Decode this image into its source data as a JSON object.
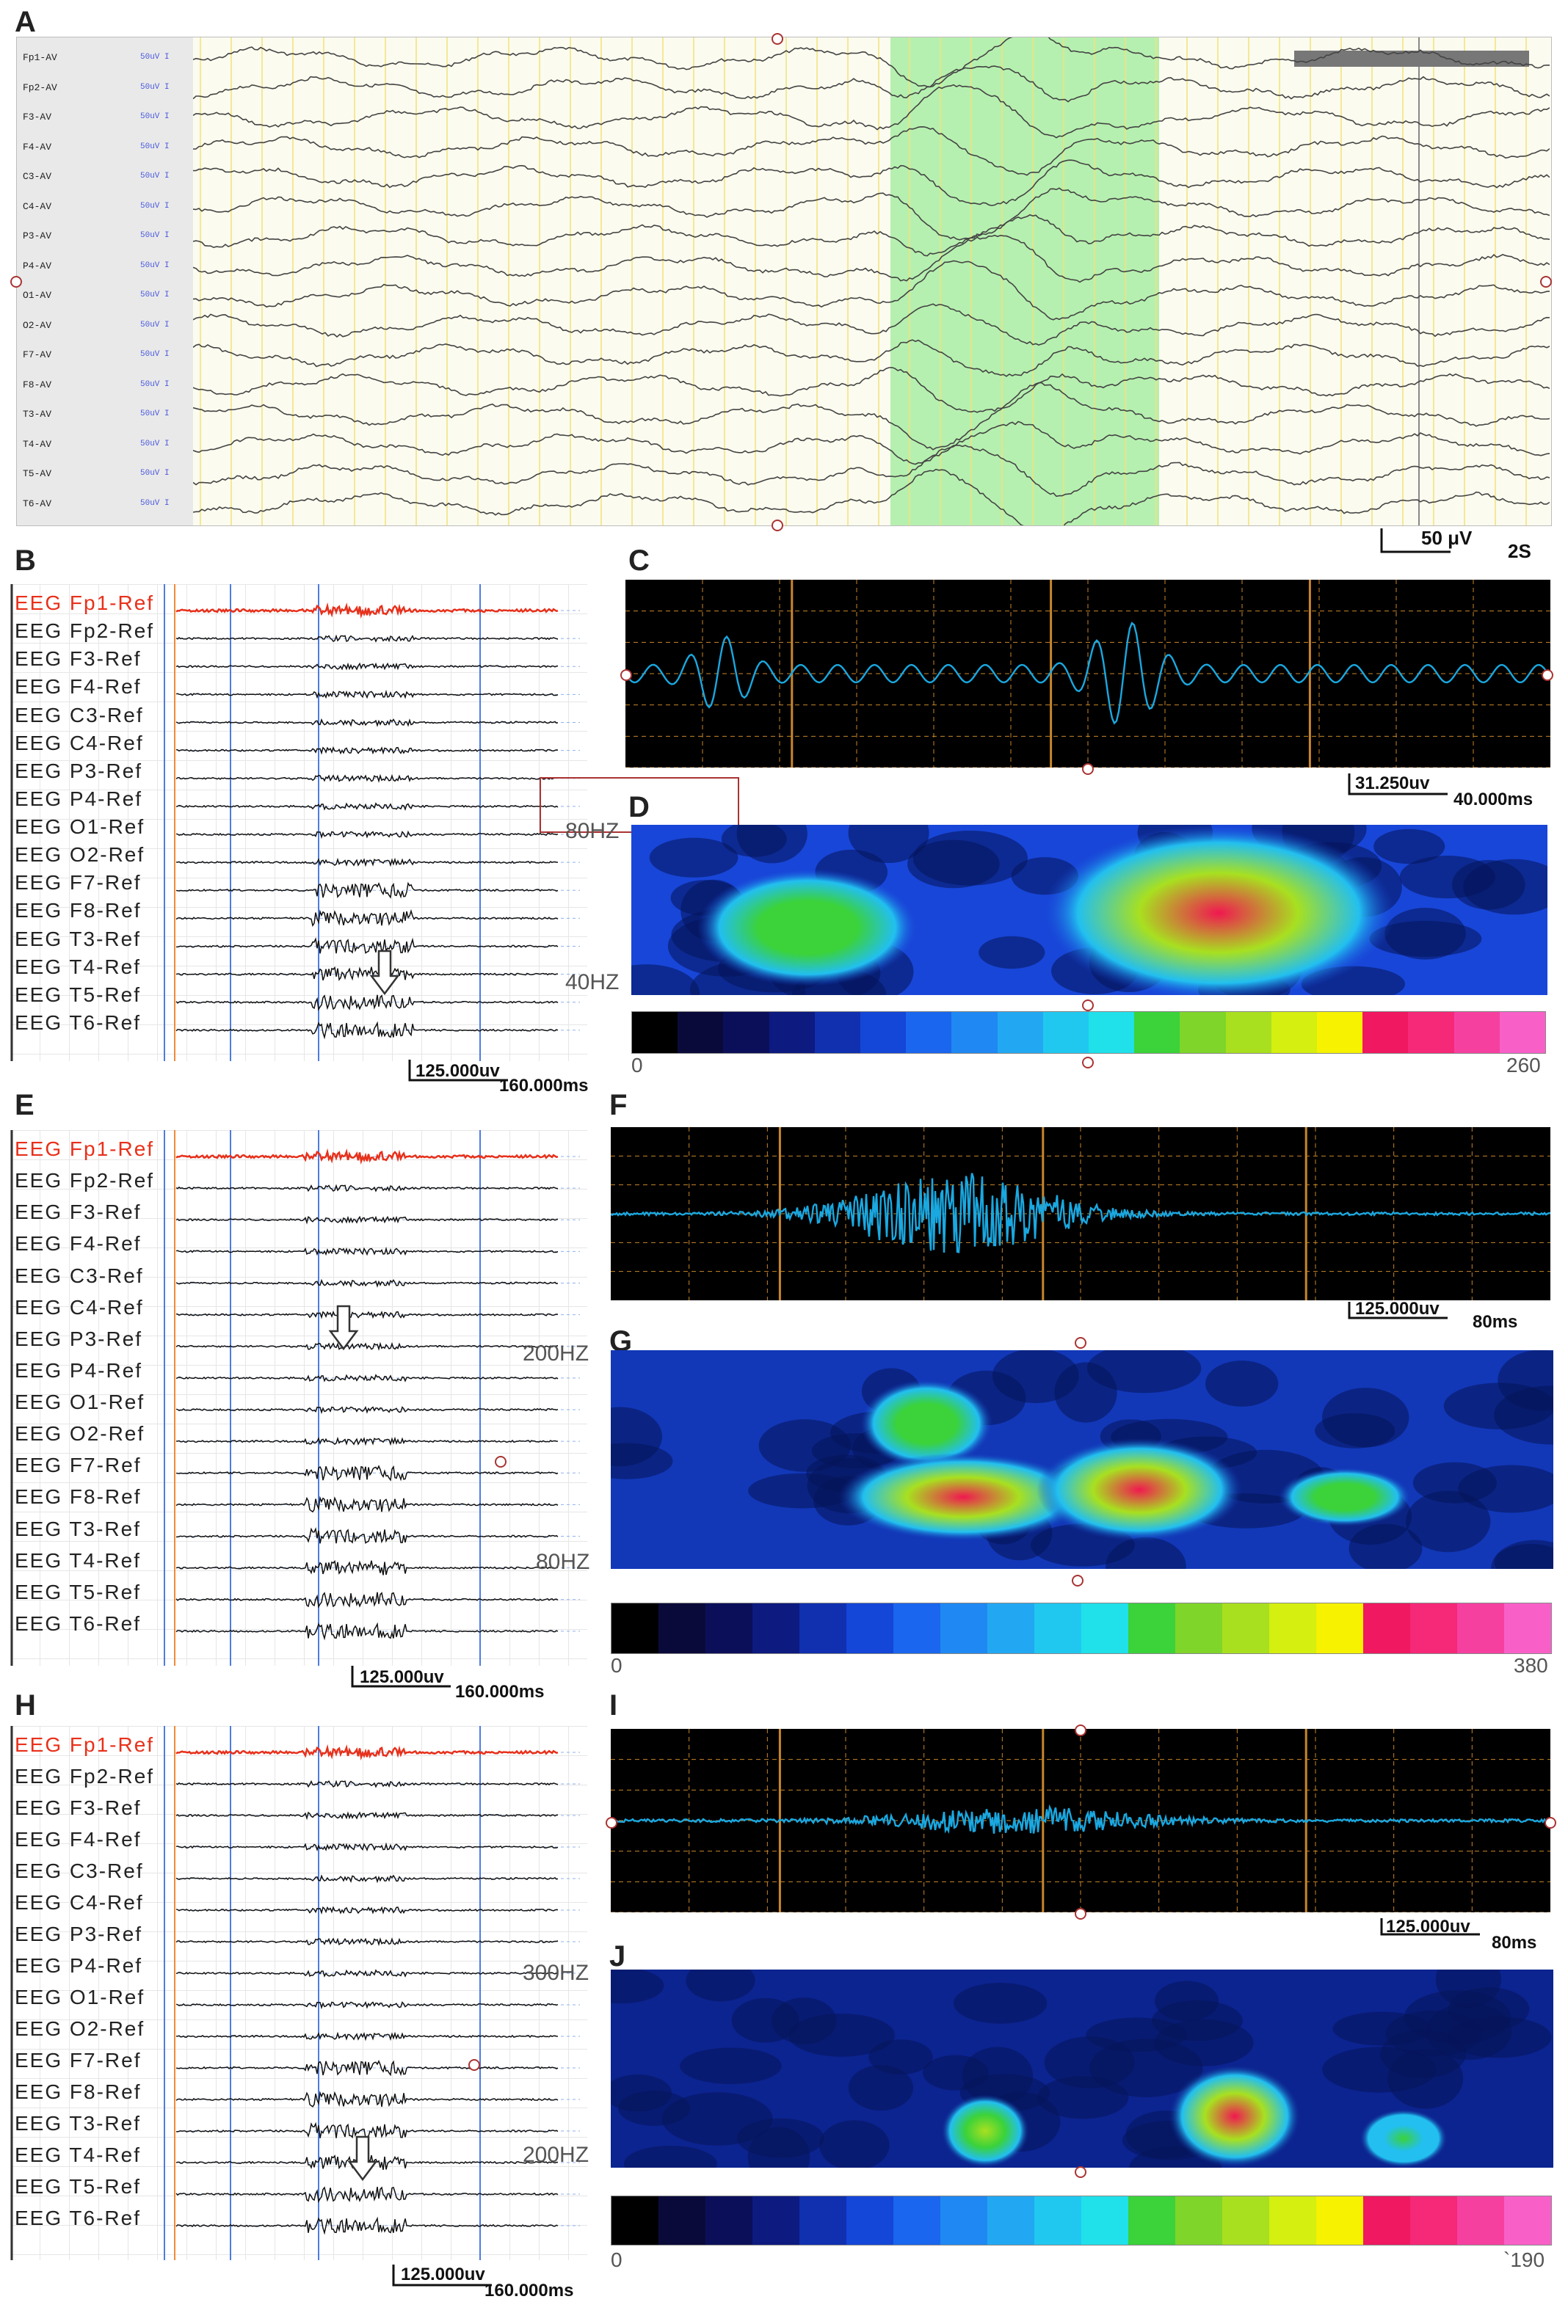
{
  "panels": {
    "a": "A",
    "b": "B",
    "c": "C",
    "d": "D",
    "e": "E",
    "f": "F",
    "g": "G",
    "h": "H",
    "i": "I",
    "j": "J"
  },
  "panel_a": {
    "channels": [
      "Fp1-AV",
      "Fp2-AV",
      "F3-AV",
      "F4-AV",
      "C3-AV",
      "C4-AV",
      "P3-AV",
      "P4-AV",
      "O1-AV",
      "O2-AV",
      "F7-AV",
      "F8-AV",
      "T3-AV",
      "T4-AV",
      "T5-AV",
      "T6-AV"
    ],
    "sensitivity": "50uV",
    "scale_amplitude": "50 μV",
    "scale_time": "2S"
  },
  "panel_b": {
    "channels": [
      "EEG Fp1-Ref",
      "EEG Fp2-Ref",
      "EEG F3-Ref",
      "EEG F4-Ref",
      "EEG C3-Ref",
      "EEG C4-Ref",
      "EEG P3-Ref",
      "EEG P4-Ref",
      "EEG O1-Ref",
      "EEG O2-Ref",
      "EEG F7-Ref",
      "EEG F8-Ref",
      "EEG T3-Ref",
      "EEG T4-Ref",
      "EEG T5-Ref",
      "EEG T6-Ref"
    ],
    "scale_amplitude": "125.000uv",
    "scale_time": "160.000ms"
  },
  "panel_c": {
    "scale_amplitude": "31.250uv",
    "scale_time": "40.000ms"
  },
  "panel_d": {
    "freq_high": "80HZ",
    "freq_low": "40HZ",
    "cbar_min": "0",
    "cbar_max": "260"
  },
  "panel_e": {
    "channels": [
      "EEG Fp1-Ref",
      "EEG Fp2-Ref",
      "EEG F3-Ref",
      "EEG F4-Ref",
      "EEG C3-Ref",
      "EEG C4-Ref",
      "EEG P3-Ref",
      "EEG P4-Ref",
      "EEG O1-Ref",
      "EEG O2-Ref",
      "EEG F7-Ref",
      "EEG F8-Ref",
      "EEG T3-Ref",
      "EEG T4-Ref",
      "EEG T5-Ref",
      "EEG T6-Ref"
    ],
    "scale_amplitude": "125.000uv",
    "scale_time": "160.000ms"
  },
  "panel_f": {
    "scale_amplitude": "125.000uv",
    "scale_time": "80ms"
  },
  "panel_g": {
    "freq_high": "200HZ",
    "freq_low": "80HZ",
    "cbar_min": "0",
    "cbar_max": "380"
  },
  "panel_h": {
    "channels": [
      "EEG Fp1-Ref",
      "EEG Fp2-Ref",
      "EEG F3-Ref",
      "EEG F4-Ref",
      "EEG C3-Ref",
      "EEG C4-Ref",
      "EEG P3-Ref",
      "EEG P4-Ref",
      "EEG O1-Ref",
      "EEG O2-Ref",
      "EEG F7-Ref",
      "EEG F8-Ref",
      "EEG T3-Ref",
      "EEG T4-Ref",
      "EEG T5-Ref",
      "EEG T6-Ref"
    ],
    "scale_amplitude": "125.000uv",
    "scale_time": "160.000ms"
  },
  "panel_i": {
    "scale_amplitude": "125.000uv",
    "scale_time": "80ms"
  },
  "panel_j": {
    "freq_high": "300HZ",
    "freq_low": "200HZ",
    "cbar_min": "0",
    "cbar_max": "`190"
  },
  "colors": {
    "wave_cyan": "#1aa8e0",
    "highlight_green": "#b6f0b0",
    "first_channel_red": "#e8301a",
    "grid_orange": "#c8862a",
    "colormap": [
      "#000000",
      "#0a0a3a",
      "#0b0f5a",
      "#0d1a80",
      "#1030b0",
      "#1446d8",
      "#1a66ee",
      "#1f88f2",
      "#22a8f2",
      "#20c8f0",
      "#20e0ea",
      "#3bd23a",
      "#7fd52a",
      "#a8e020",
      "#d4ef10",
      "#f6f200",
      "#f01860",
      "#f62878",
      "#f640a0",
      "#f860c8"
    ]
  }
}
